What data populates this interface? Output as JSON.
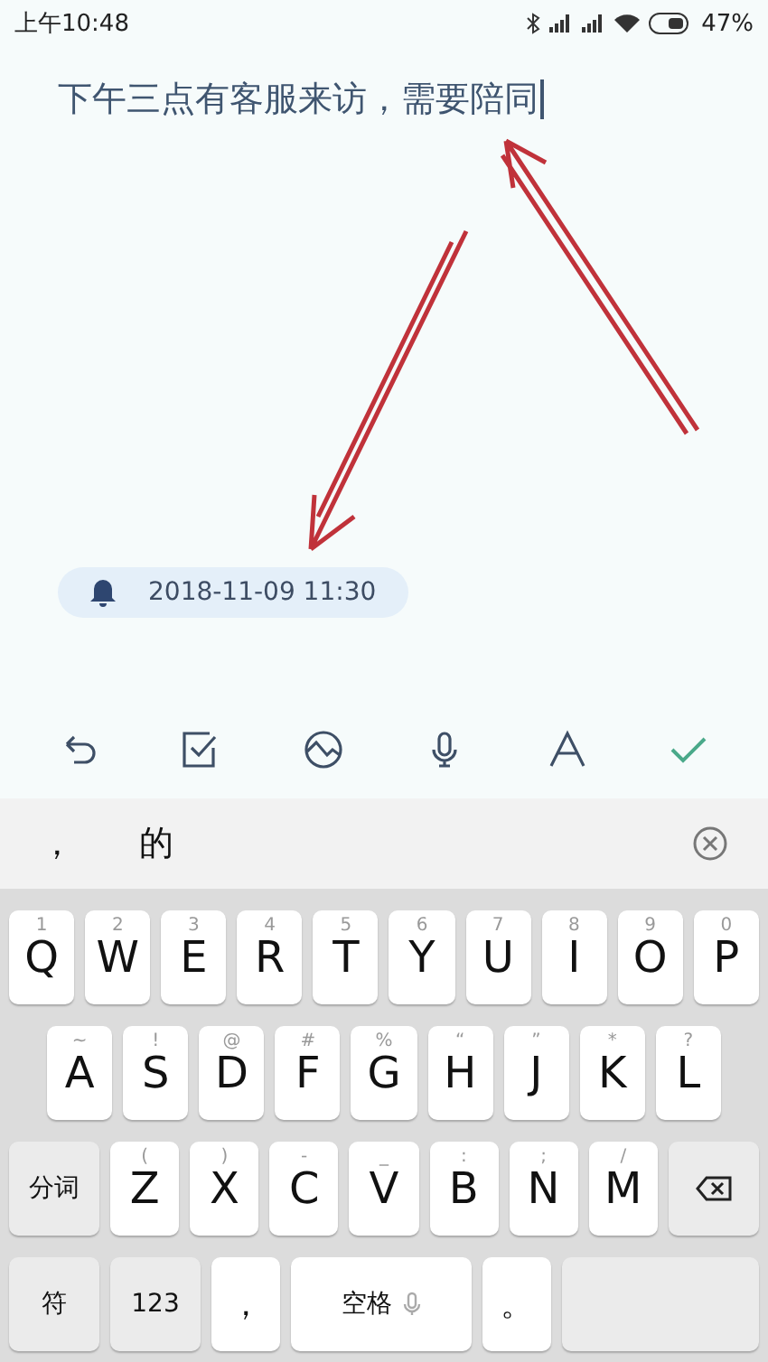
{
  "status_bar": {
    "time": "上午10:48",
    "battery": "47%"
  },
  "note": {
    "text": "下午三点有客服来访，需要陪同",
    "cursor": true
  },
  "reminder": {
    "text": "2018-11-09 11:30"
  },
  "toolbar": [
    {
      "kind": "undo"
    },
    {
      "kind": "checklist"
    },
    {
      "kind": "image"
    },
    {
      "kind": "voice"
    },
    {
      "kind": "format"
    },
    {
      "kind": "done"
    }
  ],
  "candidates": [
    {
      "text": "，"
    },
    {
      "text": "的"
    }
  ],
  "keyboard": {
    "rows": [
      {
        "keys": [
          {
            "kind": "letter",
            "label": "Q",
            "hint": "1"
          },
          {
            "kind": "letter",
            "label": "W",
            "hint": "2"
          },
          {
            "kind": "letter",
            "label": "E",
            "hint": "3"
          },
          {
            "kind": "letter",
            "label": "R",
            "hint": "4"
          },
          {
            "kind": "letter",
            "label": "T",
            "hint": "5"
          },
          {
            "kind": "letter",
            "label": "Y",
            "hint": "6"
          },
          {
            "kind": "letter",
            "label": "U",
            "hint": "7"
          },
          {
            "kind": "letter",
            "label": "I",
            "hint": "8"
          },
          {
            "kind": "letter",
            "label": "O",
            "hint": "9"
          },
          {
            "kind": "letter",
            "label": "P",
            "hint": "0"
          }
        ]
      },
      {
        "keys": [
          {
            "kind": "letter",
            "label": "A",
            "hint": "~"
          },
          {
            "kind": "letter",
            "label": "S",
            "hint": "!"
          },
          {
            "kind": "letter",
            "label": "D",
            "hint": "@"
          },
          {
            "kind": "letter",
            "label": "F",
            "hint": "#"
          },
          {
            "kind": "letter",
            "label": "G",
            "hint": "%"
          },
          {
            "kind": "letter",
            "label": "H",
            "hint": "“"
          },
          {
            "kind": "letter",
            "label": "J",
            "hint": "”"
          },
          {
            "kind": "letter",
            "label": "K",
            "hint": "*"
          },
          {
            "kind": "letter",
            "label": "L",
            "hint": "?"
          }
        ]
      },
      {
        "keys": [
          {
            "kind": "function",
            "label": "分词"
          },
          {
            "kind": "letter",
            "label": "Z",
            "hint": "("
          },
          {
            "kind": "letter",
            "label": "X",
            "hint": ")"
          },
          {
            "kind": "letter",
            "label": "C",
            "hint": "-"
          },
          {
            "kind": "letter",
            "label": "V",
            "hint": "_"
          },
          {
            "kind": "letter",
            "label": "B",
            "hint": ":"
          },
          {
            "kind": "letter",
            "label": "N",
            "hint": ";"
          },
          {
            "kind": "letter",
            "label": "M",
            "hint": "/"
          },
          {
            "kind": "backspace"
          }
        ]
      },
      {
        "keys": [
          {
            "kind": "function",
            "label": "符"
          },
          {
            "kind": "function",
            "label": "123"
          },
          {
            "kind": "punct",
            "label": "，"
          },
          {
            "kind": "space",
            "label": "空格"
          },
          {
            "kind": "punct",
            "label": "。"
          },
          {
            "kind": "blank"
          }
        ]
      }
    ]
  }
}
